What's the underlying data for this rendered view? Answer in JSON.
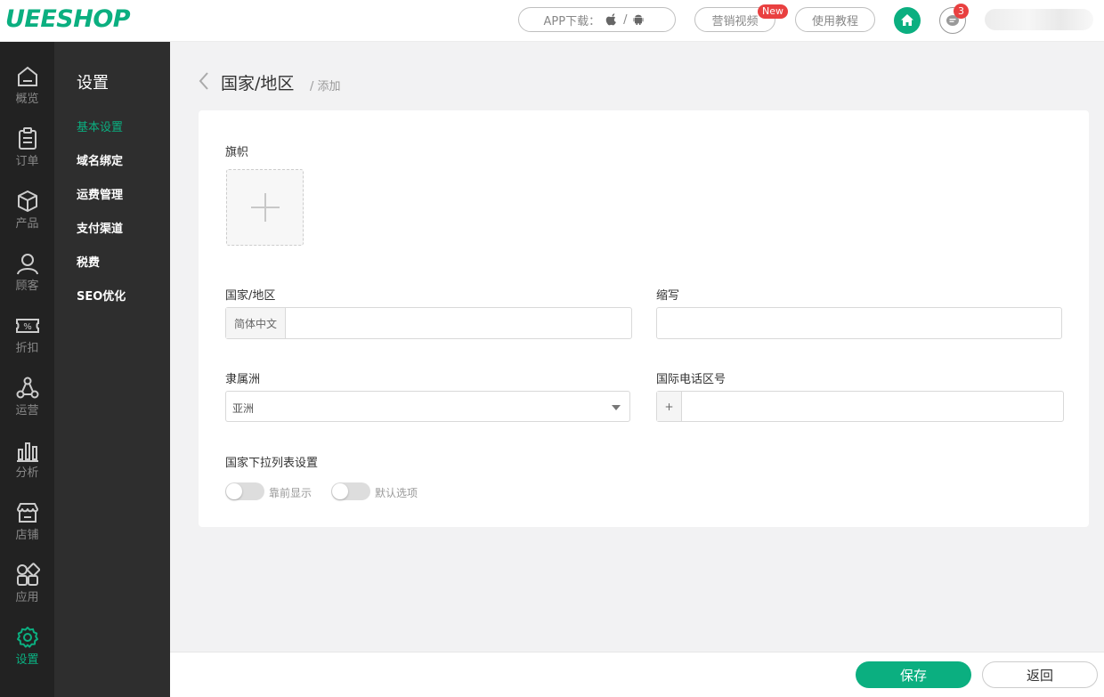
{
  "header": {
    "logo": "UEESHOP",
    "app_download": "APP下载：",
    "app_separator": "/",
    "marketing_video": "营销视频",
    "new_badge": "New",
    "tutorial": "使用教程",
    "message_count": "3"
  },
  "leftnav": {
    "items": [
      {
        "label": "概览",
        "icon": "home-outline-icon"
      },
      {
        "label": "订单",
        "icon": "clipboard-icon"
      },
      {
        "label": "产品",
        "icon": "box-icon"
      },
      {
        "label": "顾客",
        "icon": "user-icon"
      },
      {
        "label": "折扣",
        "icon": "discount-ticket-icon"
      },
      {
        "label": "运营",
        "icon": "network-icon"
      },
      {
        "label": "分析",
        "icon": "bar-chart-icon"
      },
      {
        "label": "店铺",
        "icon": "store-icon"
      },
      {
        "label": "应用",
        "icon": "apps-icon"
      },
      {
        "label": "设置",
        "icon": "gear-icon"
      }
    ],
    "active_index": 9
  },
  "subnav": {
    "title": "设置",
    "items": [
      "基本设置",
      "域名绑定",
      "运费管理",
      "支付渠道",
      "税费",
      "SEO优化"
    ],
    "active_index": 0
  },
  "breadcrumb": {
    "title": "国家/地区",
    "sub": "/ 添加"
  },
  "form": {
    "flag_label": "旗帜",
    "country_label": "国家/地区",
    "country_addon": "简体中文",
    "country_value": "",
    "abbr_label": "缩写",
    "abbr_value": "",
    "continent_label": "隶属洲",
    "continent_value": "亚洲",
    "phone_label": "国际电话区号",
    "phone_addon": "+",
    "phone_value": "",
    "dropdown_settings_label": "国家下拉列表设置",
    "toggle_front_label": "靠前显示",
    "toggle_front_on": false,
    "toggle_default_label": "默认选项",
    "toggle_default_on": false
  },
  "footer": {
    "save": "保存",
    "back": "返回"
  },
  "colors": {
    "accent": "#0baf80",
    "badge": "#e94040",
    "nav_bg": "#222222",
    "subnav_bg": "#2e2e2e"
  }
}
